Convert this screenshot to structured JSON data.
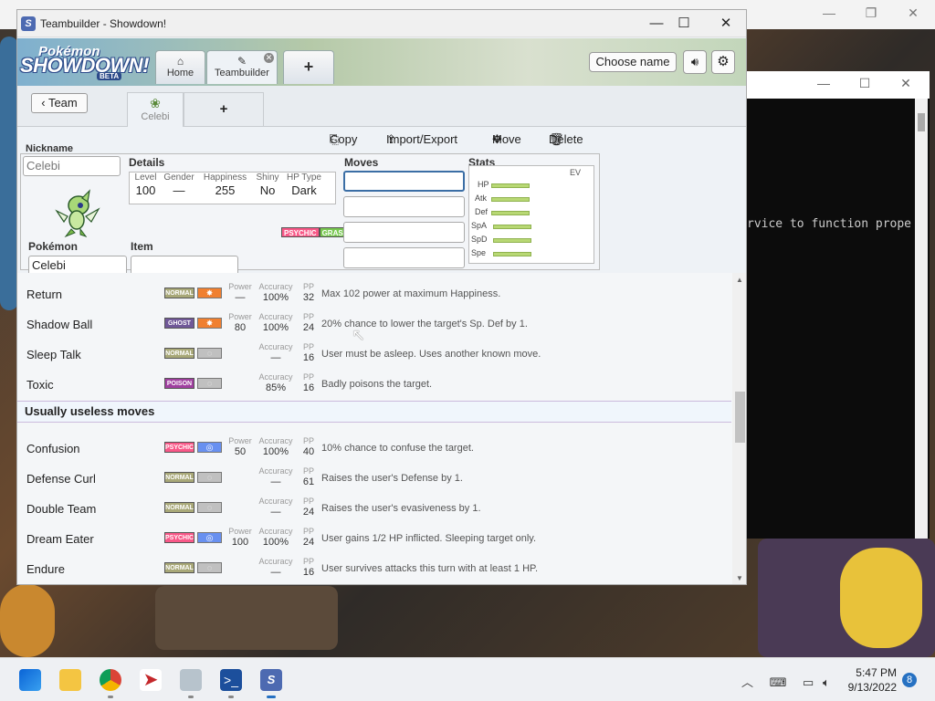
{
  "window": {
    "title": "Teambuilder - Showdown!"
  },
  "logo": {
    "line1": "Pokémon",
    "line2": "SHOWDOWN!",
    "badge": "BETA"
  },
  "topbar": {
    "home_label": "Home",
    "teambuilder_label": "Teambuilder",
    "new_tab_label": "+",
    "choose_name_label": "Choose name"
  },
  "subbar": {
    "back_label": "Team",
    "pokemon_tab_label": "Celebi",
    "add_label": "+"
  },
  "actions": {
    "copy": "Copy",
    "import_export": "Import/Export",
    "move": "Move",
    "delete": "Delete"
  },
  "set": {
    "nickname_label": "Nickname",
    "nickname_value": "Celebi",
    "details_label": "Details",
    "details": [
      {
        "label": "Level",
        "value": "100"
      },
      {
        "label": "Gender",
        "value": "—"
      },
      {
        "label": "Happiness",
        "value": "255"
      },
      {
        "label": "Shiny",
        "value": "No"
      },
      {
        "label": "HP Type",
        "value": "Dark"
      }
    ],
    "types": [
      "PSYCHIC",
      "GRASS"
    ],
    "pokemon_label": "Pokémon",
    "pokemon_value": "Celebi",
    "item_label": "Item",
    "item_value": "",
    "moves_label": "Moves",
    "stats_label": "Stats",
    "ev_label": "EV",
    "stats": [
      "HP",
      "Atk",
      "Def",
      "SpA",
      "SpD",
      "Spe"
    ]
  },
  "moves_top": [
    {
      "name": "Return",
      "type": "NORMAL",
      "category": "physical",
      "power_label": "Power",
      "power": "—",
      "accuracy_label": "Accuracy",
      "accuracy": "100%",
      "pp_label": "PP",
      "pp": "32",
      "desc": "Max 102 power at maximum Happiness."
    },
    {
      "name": "Shadow Ball",
      "type": "GHOST",
      "category": "physical",
      "power_label": "Power",
      "power": "80",
      "accuracy_label": "Accuracy",
      "accuracy": "100%",
      "pp_label": "PP",
      "pp": "24",
      "desc": "20% chance to lower the target's Sp. Def by 1."
    },
    {
      "name": "Sleep Talk",
      "type": "NORMAL",
      "category": "status",
      "power_label": "",
      "power": "",
      "accuracy_label": "Accuracy",
      "accuracy": "—",
      "pp_label": "PP",
      "pp": "16",
      "desc": "User must be asleep. Uses another known move."
    },
    {
      "name": "Toxic",
      "type": "POISON",
      "category": "status",
      "power_label": "",
      "power": "",
      "accuracy_label": "Accuracy",
      "accuracy": "85%",
      "pp_label": "PP",
      "pp": "16",
      "desc": "Badly poisons the target."
    }
  ],
  "section_useless": "Usually useless moves",
  "moves_bottom": [
    {
      "name": "Confusion",
      "type": "PSYCHIC",
      "category": "special",
      "power_label": "Power",
      "power": "50",
      "accuracy_label": "Accuracy",
      "accuracy": "100%",
      "pp_label": "PP",
      "pp": "40",
      "desc": "10% chance to confuse the target."
    },
    {
      "name": "Defense Curl",
      "type": "NORMAL",
      "category": "status",
      "power_label": "",
      "power": "",
      "accuracy_label": "Accuracy",
      "accuracy": "—",
      "pp_label": "PP",
      "pp": "61",
      "desc": "Raises the user's Defense by 1."
    },
    {
      "name": "Double Team",
      "type": "NORMAL",
      "category": "status",
      "power_label": "",
      "power": "",
      "accuracy_label": "Accuracy",
      "accuracy": "—",
      "pp_label": "PP",
      "pp": "24",
      "desc": "Raises the user's evasiveness by 1."
    },
    {
      "name": "Dream Eater",
      "type": "PSYCHIC",
      "category": "special",
      "power_label": "Power",
      "power": "100",
      "accuracy_label": "Accuracy",
      "accuracy": "100%",
      "pp_label": "PP",
      "pp": "24",
      "desc": "User gains 1/2 HP inflicted. Sleeping target only."
    },
    {
      "name": "Endure",
      "type": "NORMAL",
      "category": "status",
      "power_label": "",
      "power": "",
      "accuracy_label": "Accuracy",
      "accuracy": "—",
      "pp_label": "PP",
      "pp": "16",
      "desc": "User survives attacks this turn with at least 1 HP."
    }
  ],
  "type_colors": {
    "NORMAL": "#a8a878",
    "GHOST": "#705898",
    "POISON": "#a040a0",
    "PSYCHIC": "#f85888",
    "GRASS": "#78c850"
  },
  "console": {
    "text": "rvice to function prope"
  },
  "taskbar": {
    "time": "5:47 PM",
    "date": "9/13/2022",
    "notifications": "8"
  }
}
